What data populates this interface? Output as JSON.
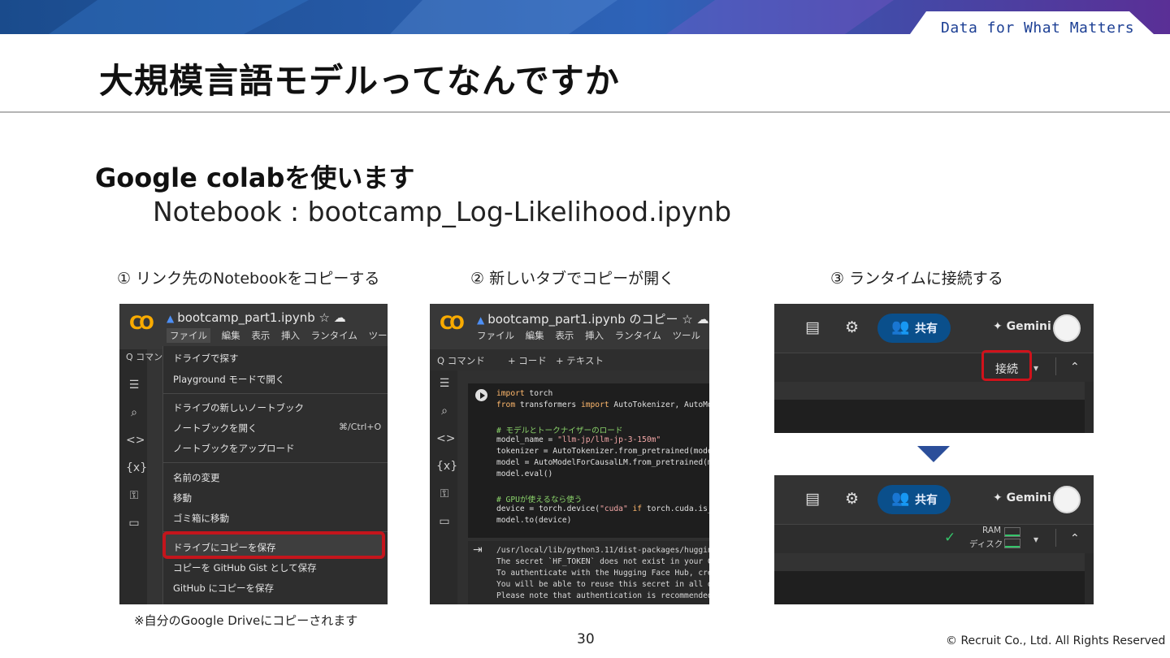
{
  "header": {
    "tagline": "Data for What Matters",
    "title": "大規模言語モデルってなんですか"
  },
  "content": {
    "heading": "Google colabを使います",
    "notebook": "Notebook : bootcamp_Log-Likelihood.ipynb"
  },
  "steps": [
    {
      "caption": "① リンク先のNotebookをコピーする"
    },
    {
      "caption": "② 新しいタブでコピーが開く"
    },
    {
      "caption": "③ ランタイムに接続する"
    }
  ],
  "shot1": {
    "logo": "CO",
    "filename": "bootcamp_part1.ipynb",
    "menubar": [
      "ファイル",
      "編集",
      "表示",
      "挿入",
      "ランタイム",
      "ツール"
    ],
    "search_fragment": "Q コマン",
    "menu_items": [
      "ドライブで探す",
      "Playground モードで開く",
      "ドライブの新しいノートブック",
      "ノートブックを開く",
      "ノートブックをアップロード",
      "名前の変更",
      "移動",
      "ゴミ箱に移動",
      "ドライブにコピーを保存",
      "コピーを GitHub Gist として保存",
      "GitHub にコピーを保存"
    ],
    "open_shortcut": "⌘/Ctrl+O"
  },
  "shot2": {
    "filename": "bootcamp_part1.ipynb のコピー",
    "menubar": [
      "ファイル",
      "編集",
      "表示",
      "挿入",
      "ランタイム",
      "ツール",
      "ヘル"
    ],
    "toolbar": [
      "Q コマンド",
      "+ コード",
      "+ テキスト"
    ],
    "code": [
      {
        "pre": "import",
        "rest": " torch"
      },
      {
        "pre": "from",
        "rest": " transformers ",
        "mid": "import",
        "tail": " AutoTokenizer, AutoMode"
      },
      {
        "comment": "# モデルとトークナイザーのロード"
      },
      {
        "plain": "model_name = ",
        "str": "\"llm-jp/llm-jp-3-150m\""
      },
      {
        "plain": "tokenizer = AutoTokenizer.from_pretrained(model_"
      },
      {
        "plain": "model = AutoModelForCausalLM.from_pretrained(mode"
      },
      {
        "plain": "model.eval()"
      },
      {
        "comment": "# GPUが使えるなら使う"
      },
      {
        "plain": "device = torch.device(",
        "str": "\"cuda\"",
        "kw2": " if",
        "tail": " torch.cuda.is_av"
      },
      {
        "plain": "model.to(device)"
      }
    ],
    "output": [
      "/usr/local/lib/python3.11/dist-packages/huggingfa",
      "The secret `HF_TOKEN` does not exist in your Cola",
      "To authenticate with the Hugging Face Hub, create",
      "You will be able to reuse this secret in all of y",
      "Please note that authentication is recommended bu"
    ]
  },
  "shot3": {
    "share_label": "共有",
    "gemini_label": "Gemini",
    "connect_label": "接続",
    "ram_label": "RAM",
    "disk_label": "ディスク"
  },
  "footer": {
    "note": "※自分のGoogle Driveにコピーされます",
    "page_number": "30",
    "copyright": "© Recruit Co., Ltd. All Rights Reserved"
  }
}
